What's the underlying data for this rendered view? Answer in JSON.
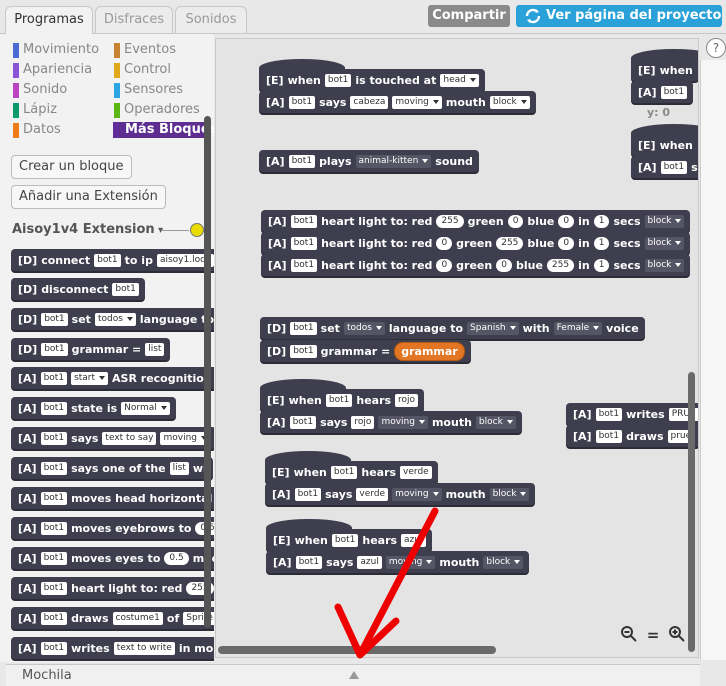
{
  "tabs": [
    "Programas",
    "Disfraces",
    "Sonidos"
  ],
  "header": {
    "share_label": "Compartir",
    "project_label": "Ver página del proyecto"
  },
  "categories": [
    {
      "label": "Movimiento",
      "color": "#4a6cd4"
    },
    {
      "label": "Apariencia",
      "color": "#8a55d7"
    },
    {
      "label": "Sonido",
      "color": "#bb42c3"
    },
    {
      "label": "Lápiz",
      "color": "#0e9a6c"
    },
    {
      "label": "Datos",
      "color": "#ee7d16"
    },
    {
      "label": "Eventos",
      "color": "#c88330"
    },
    {
      "label": "Control",
      "color": "#e1a91a"
    },
    {
      "label": "Sensores",
      "color": "#2ca5e2"
    },
    {
      "label": "Operadores",
      "color": "#5cb712"
    },
    {
      "label": "Más Bloques",
      "color": "#632d99"
    }
  ],
  "buttons": {
    "make_block": "Crear un bloque",
    "add_extension": "Añadir una Extensión"
  },
  "extension": {
    "name": "Aisoy1v4 Extension"
  },
  "palette": [
    {
      "tag": "[D]",
      "pre": "connect",
      "in1": "bot1",
      "mid": "to ip",
      "in2": "aisoy1.loca"
    },
    {
      "tag": "[D]",
      "pre": "disconnect",
      "in1": "bot1"
    },
    {
      "tag": "[D]",
      "in1": "bot1",
      "mid": "set",
      "dd1": "todos",
      "post": "language to"
    },
    {
      "tag": "[D]",
      "in1": "bot1",
      "mid": "grammar =",
      "in2": "list"
    },
    {
      "tag": "[A]",
      "in1": "bot1",
      "dd1": "start",
      "post": "ASR recognition"
    },
    {
      "tag": "[A]",
      "in1": "bot1",
      "mid": "state is",
      "dd1": "Normal"
    },
    {
      "tag": "[A]",
      "in1": "bot1",
      "mid": "says",
      "in2": "text to say",
      "dd1": "moving"
    },
    {
      "tag": "[A]",
      "in1": "bot1",
      "mid": "says one of the",
      "in2": "list",
      "post": "wi"
    },
    {
      "tag": "[A]",
      "in1": "bot1",
      "mid": "moves head horizontal",
      "post": "to"
    },
    {
      "tag": "[A]",
      "in1": "bot1",
      "mid": "moves eyebrows to",
      "num": "0.5"
    },
    {
      "tag": "[A]",
      "in1": "bot1",
      "mid": "moves eyes to",
      "num": "0.5",
      "post": "med"
    },
    {
      "tag": "[A]",
      "in1": "bot1",
      "mid": "heart light to: red",
      "num": "255"
    },
    {
      "tag": "[A]",
      "in1": "bot1",
      "mid": "draws",
      "in2": "costume1",
      "post": "of",
      "in3": "Sprite1"
    },
    {
      "tag": "[A]",
      "in1": "bot1",
      "mid": "writes",
      "in2": "text to write",
      "post": "in mo"
    }
  ],
  "script": {
    "e_head": {
      "tag": "[E]",
      "w1": "when",
      "in": "bot1",
      "w2": "is touched at",
      "dd": "head"
    },
    "a_cabeza": {
      "tag": "[A]",
      "in": "bot1",
      "w1": "says",
      "in2": "cabeza",
      "dd": "moving",
      "w2": "mouth",
      "dd2": "block"
    },
    "a_plays": {
      "tag": "[A]",
      "in": "bot1",
      "w1": "plays",
      "dd": "animal-kitten",
      "w2": "sound"
    },
    "hearts": [
      {
        "tag": "[A]",
        "in": "bot1",
        "w1": "heart light to: red",
        "r": "255",
        "w2": "green",
        "g": "0",
        "w3": "blue",
        "b": "0",
        "w4": "in",
        "t": "1",
        "w5": "secs",
        "dd": "block"
      },
      {
        "tag": "[A]",
        "in": "bot1",
        "w1": "heart light to: red",
        "r": "0",
        "w2": "green",
        "g": "255",
        "w3": "blue",
        "b": "0",
        "w4": "in",
        "t": "1",
        "w5": "secs",
        "dd": "block"
      },
      {
        "tag": "[A]",
        "in": "bot1",
        "w1": "heart light to: red",
        "r": "0",
        "w2": "green",
        "g": "0",
        "w3": "blue",
        "b": "255",
        "w4": "in",
        "t": "1",
        "w5": "secs",
        "dd": "block"
      }
    ],
    "d_set": {
      "tag": "[D]",
      "in": "bot1",
      "w1": "set",
      "dd": "todos",
      "w2": "language to",
      "dd2": "Spanish",
      "w3": "with",
      "dd3": "Female",
      "w4": "voice"
    },
    "d_grammar": {
      "tag": "[D]",
      "in": "bot1",
      "w1": "grammar =",
      "rep": "grammar"
    },
    "e_rojo": {
      "tag": "[E]",
      "w1": "when",
      "in": "bot1",
      "w2": "hears",
      "in2": "rojo"
    },
    "a_rojo": {
      "tag": "[A]",
      "in": "bot1",
      "w1": "says",
      "in2": "rojo",
      "dd": "moving",
      "w2": "mouth",
      "dd2": "block"
    },
    "e_verde": {
      "tag": "[E]",
      "w1": "when",
      "in": "bot1",
      "w2": "hears",
      "in2": "verde"
    },
    "a_verde": {
      "tag": "[A]",
      "in": "bot1",
      "w1": "says",
      "in2": "verde",
      "dd": "moving",
      "w2": "mouth",
      "dd2": "block"
    },
    "e_azul": {
      "tag": "[E]",
      "w1": "when",
      "in": "bot1",
      "w2": "hears",
      "in2": "azul"
    },
    "a_azul": {
      "tag": "[A]",
      "in": "bot1",
      "w1": "says",
      "in2": "azul",
      "dd": "moving",
      "w2": "mouth",
      "dd2": "block"
    },
    "a_writes": {
      "tag": "[A]",
      "in": "bot1",
      "w1": "writes",
      "in2": "PRUE"
    },
    "a_draws": {
      "tag": "[A]",
      "in": "bot1",
      "w1": "draws",
      "in2": "prue"
    },
    "r1_e": {
      "tag": "[E]",
      "w1": "when"
    },
    "r1_a": {
      "tag": "[A]",
      "in": "bot1"
    },
    "r2_e": {
      "tag": "[E]",
      "w1": "when"
    },
    "r2_a": {
      "tag": "[A]",
      "in": "bot1",
      "w1": "sa"
    },
    "coord_y": "y: 0"
  },
  "zoom": {
    "out": "−",
    "reset": "=",
    "in": "+"
  },
  "backpack": {
    "label": "Mochila"
  },
  "help": "?",
  "colors": {
    "share": "#8a8a8a",
    "project": "#2aa1d8",
    "block": "#3e3e4e",
    "reporter": "#e27624",
    "arrow": "#ee0000"
  }
}
